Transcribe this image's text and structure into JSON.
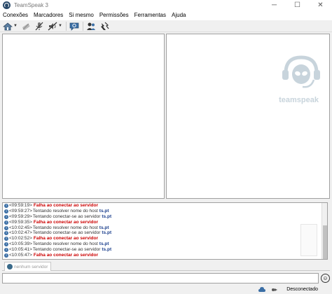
{
  "window": {
    "title": "TeamSpeak 3",
    "minimize": "─",
    "maximize": "☐",
    "close": "✕"
  },
  "menu": [
    "Conexões",
    "Marcadores",
    "Si mesmo",
    "Permissões",
    "Ferramentas",
    "Ajuda"
  ],
  "toolbar": {
    "icons": [
      "connect-icon",
      "disconnect-icon",
      "mute-microphone-icon",
      "mute-speakers-icon",
      "away-icon",
      "contacts-icon",
      "whisper-icon"
    ]
  },
  "logo": {
    "text": "teamspeak"
  },
  "log": [
    {
      "time": "<09:59:19>",
      "type": "error",
      "msg": "Falha ao conectar ao servidor"
    },
    {
      "time": "<09:59:27>",
      "type": "info",
      "msg": "Tentando resolver nome do host",
      "host": "ts.pt"
    },
    {
      "time": "<09:59:29>",
      "type": "info",
      "msg": "Tentando conectar-se ao servidor",
      "host": "ts.pt"
    },
    {
      "time": "<09:59:35>",
      "type": "error",
      "msg": "Falha ao conectar ao servidor"
    },
    {
      "time": "<10:02:45>",
      "type": "info",
      "msg": "Tentando resolver nome do host",
      "host": "ts.pt"
    },
    {
      "time": "<10:02:47>",
      "type": "info",
      "msg": "Tentando conectar-se ao servidor",
      "host": "ts.pt"
    },
    {
      "time": "<10:02:52>",
      "type": "error",
      "msg": "Falha ao conectar ao servidor"
    },
    {
      "time": "<10:05:39>",
      "type": "info",
      "msg": "Tentando resolver nome do host",
      "host": "ts.pt"
    },
    {
      "time": "<10:05:41>",
      "type": "info",
      "msg": "Tentando conectar-se ao servidor",
      "host": "ts.pt"
    },
    {
      "time": "<10:05:47>",
      "type": "error",
      "msg": "Falha ao conectar ao servidor"
    }
  ],
  "tabs": [
    {
      "label": "nenhum servidor"
    }
  ],
  "chat": {
    "placeholder": ""
  },
  "status": {
    "text": "Desconectado"
  },
  "colors": {
    "error": "#cc0000",
    "host": "#1a3e8c",
    "info_icon": "#3a6ea5"
  }
}
